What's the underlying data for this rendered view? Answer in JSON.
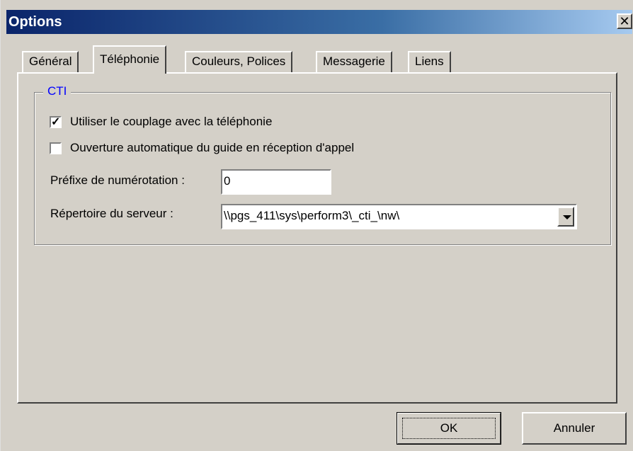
{
  "window": {
    "title": "Options",
    "close_icon": "close-icon"
  },
  "tabs": [
    {
      "label": "Général",
      "active": false
    },
    {
      "label": "Téléphonie",
      "active": true
    },
    {
      "label": "Couleurs, Polices",
      "active": false
    },
    {
      "label": "Messagerie",
      "active": false
    },
    {
      "label": "Liens",
      "active": false
    }
  ],
  "cti": {
    "group_title": "CTI",
    "checkbox1": {
      "label": "Utiliser le couplage avec la téléphonie",
      "checked": true,
      "mark": "✓"
    },
    "checkbox2": {
      "label": "Ouverture automatique du guide en réception d'appel",
      "checked": false,
      "mark": ""
    },
    "prefix": {
      "label": "Préfixe de numérotation :",
      "value": "0"
    },
    "server_dir": {
      "label": "Répertoire du serveur :",
      "value": "\\\\pgs_411\\sys\\perform3\\_cti_\\nw\\"
    }
  },
  "buttons": {
    "ok": "OK",
    "cancel": "Annuler"
  }
}
